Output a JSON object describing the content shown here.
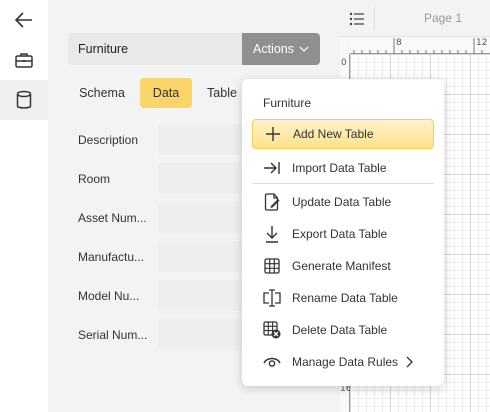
{
  "rail": {
    "icons": [
      "back-arrow-icon",
      "briefcase-icon",
      "database-icon"
    ]
  },
  "form": {
    "dataset_name": "Furniture",
    "actions_label": "Actions",
    "tabs": [
      {
        "label": "Schema"
      },
      {
        "label": "Data"
      },
      {
        "label": "Table"
      }
    ],
    "fields": [
      {
        "label": "Description",
        "value": ""
      },
      {
        "label": "Room",
        "value": ""
      },
      {
        "label": "Asset Num...",
        "value": ""
      },
      {
        "label": "Manufactu...",
        "value": ""
      },
      {
        "label": "Model Nu...",
        "value": ""
      },
      {
        "label": "Serial Num...",
        "value": ""
      }
    ]
  },
  "canvas": {
    "page_label": "Page 1",
    "ruler_top": [
      "8",
      "12"
    ],
    "ruler_left": [
      "0",
      "16"
    ]
  },
  "menu": {
    "header": "Furniture",
    "items": [
      {
        "label": "Add New Table",
        "icon": "plus-icon"
      },
      {
        "label": "Import Data Table",
        "icon": "import-arrow-icon"
      },
      {
        "label": "Update Data Table",
        "icon": "edit-document-icon"
      },
      {
        "label": "Export Data Table",
        "icon": "download-arrow-icon"
      },
      {
        "label": "Generate Manifest",
        "icon": "table-grid-icon"
      },
      {
        "label": "Rename Data Table",
        "icon": "rename-cursor-icon"
      },
      {
        "label": "Delete Data Table",
        "icon": "table-delete-icon"
      },
      {
        "label": "Manage Data Rules",
        "icon": "eye-icon"
      }
    ]
  },
  "colors": {
    "accent": "#fbd56a",
    "actions_button": "#8f8f8f",
    "panel_bg": "#f3f3f3"
  }
}
